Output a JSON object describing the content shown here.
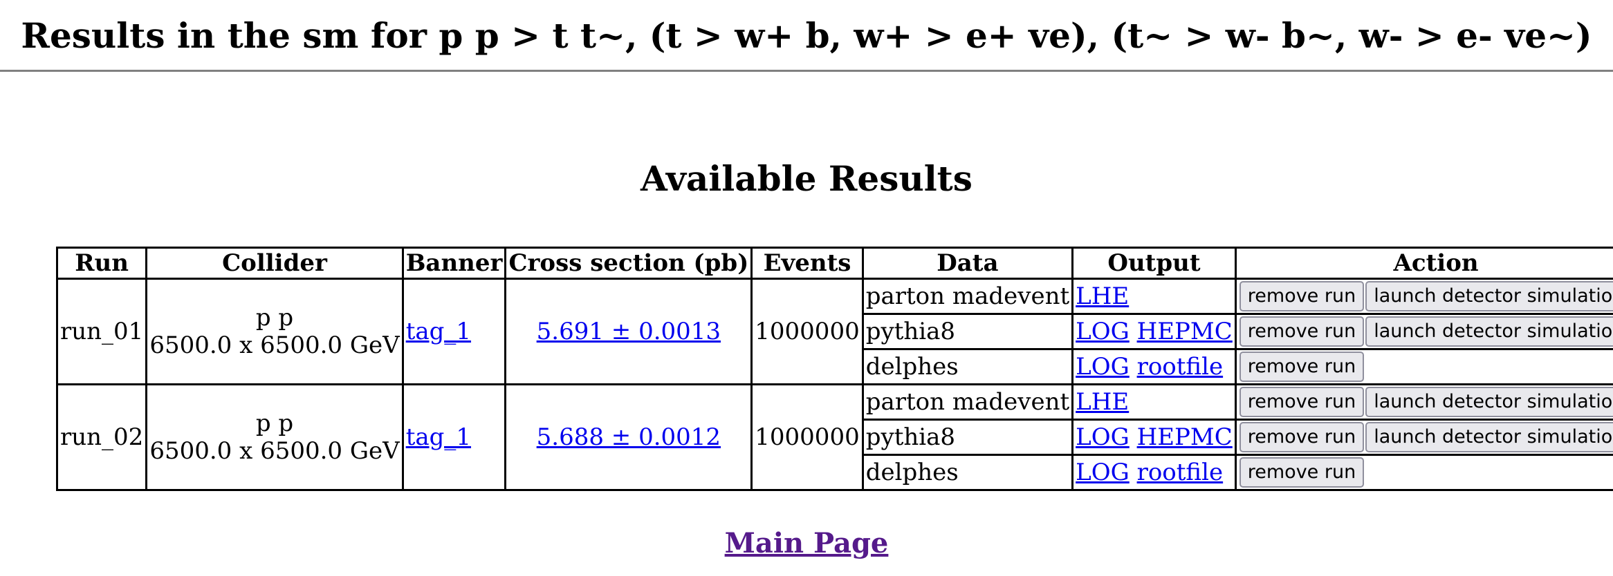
{
  "page": {
    "title": "Results in the sm for p p > t t~, (t > w+ b, w+ > e+ ve), (t~ > w- b~, w- > e- ve~)",
    "section_title": "Available Results",
    "main_page_link": "Main Page"
  },
  "table": {
    "headers": [
      "Run",
      "Collider",
      "Banner",
      "Cross section (pb)",
      "Events",
      "Data",
      "Output",
      "Action"
    ],
    "runs": [
      {
        "run": "run_01",
        "collider_beams": "p p",
        "collider_energy": "6500.0 x 6500.0 GeV",
        "banner": "tag_1",
        "cross_section": "5.691 ± 0.0013",
        "events": "1000000",
        "steps": [
          {
            "data": "parton madevent",
            "outputs": [
              "LHE"
            ],
            "actions": [
              "remove run",
              "launch detector simulation"
            ]
          },
          {
            "data": "pythia8",
            "outputs": [
              "LOG",
              "HEPMC"
            ],
            "actions": [
              "remove run",
              "launch detector simulation"
            ]
          },
          {
            "data": "delphes",
            "outputs": [
              "LOG",
              "rootfile"
            ],
            "actions": [
              "remove run"
            ]
          }
        ]
      },
      {
        "run": "run_02",
        "collider_beams": "p p",
        "collider_energy": "6500.0 x 6500.0 GeV",
        "banner": "tag_1",
        "cross_section": "5.688 ± 0.0012",
        "events": "1000000",
        "steps": [
          {
            "data": "parton madevent",
            "outputs": [
              "LHE"
            ],
            "actions": [
              "remove run",
              "launch detector simulation"
            ]
          },
          {
            "data": "pythia8",
            "outputs": [
              "LOG",
              "HEPMC"
            ],
            "actions": [
              "remove run",
              "launch detector simulation"
            ]
          },
          {
            "data": "delphes",
            "outputs": [
              "LOG",
              "rootfile"
            ],
            "actions": [
              "remove run"
            ]
          }
        ]
      }
    ]
  },
  "colors": {
    "link": "#0000ee",
    "visited_link": "#551a8b",
    "rule": "#808080",
    "button_bg": "#e9e9ed"
  }
}
